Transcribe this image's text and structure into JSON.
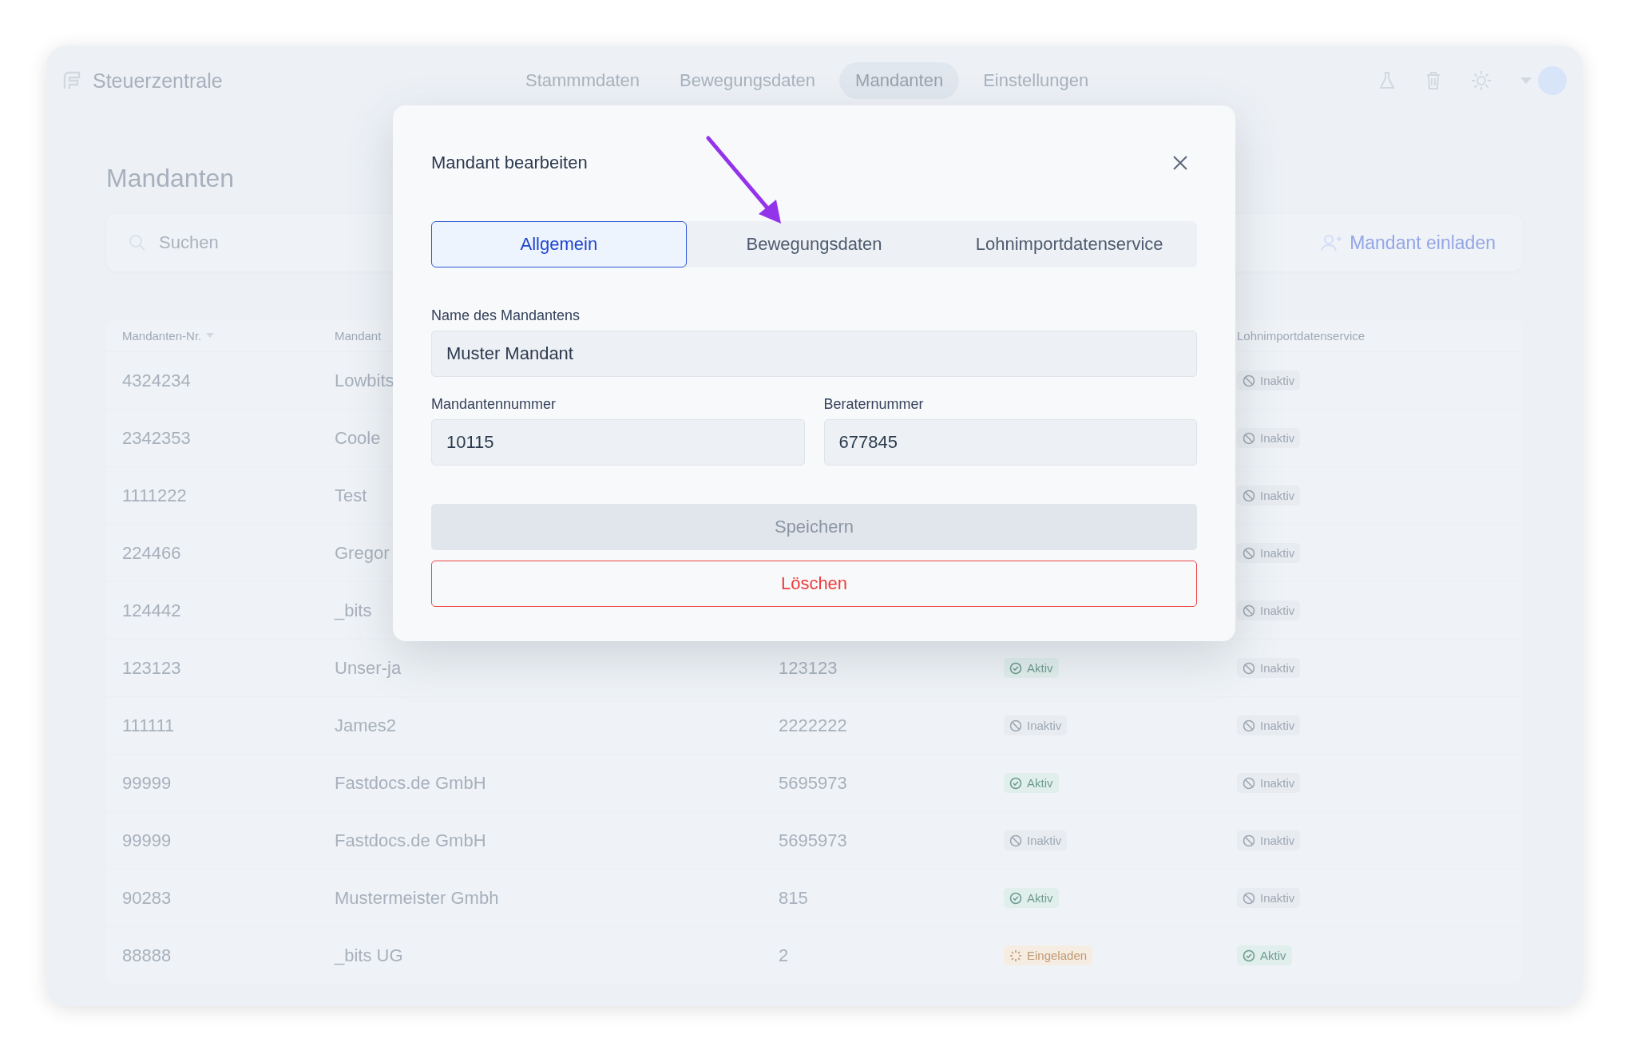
{
  "app": {
    "name": "Steuerzentrale"
  },
  "nav": [
    {
      "label": "Stammmdaten",
      "selected": false
    },
    {
      "label": "Bewegungsdaten",
      "selected": false
    },
    {
      "label": "Mandanten",
      "selected": true
    },
    {
      "label": "Einstellungen",
      "selected": false
    }
  ],
  "page": {
    "title": "Mandanten"
  },
  "search": {
    "placeholder": "Suchen"
  },
  "invite_button": {
    "label": "Mandant einladen"
  },
  "table": {
    "header": {
      "number": {
        "label": "Mandanten-Nr.",
        "sorted": true
      },
      "name": {
        "label": "Mandant"
      },
      "payroll": {
        "label": "Lohnimportdatenservice"
      }
    },
    "rows": [
      {
        "number": "4324234",
        "name": "Lowbits",
        "payroll": {
          "kind": "inactive",
          "label": "Inaktiv"
        }
      },
      {
        "number": "2342353",
        "name": "Coole",
        "payroll": {
          "kind": "inactive",
          "label": "Inaktiv"
        }
      },
      {
        "number": "1111222",
        "name": "Test",
        "payroll": {
          "kind": "inactive",
          "label": "Inaktiv"
        }
      },
      {
        "number": "224466",
        "name": "Gregor",
        "payroll": {
          "kind": "inactive",
          "label": "Inaktiv"
        }
      },
      {
        "number": "124442",
        "name": "_bits",
        "payroll": {
          "kind": "inactive",
          "label": "Inaktiv"
        }
      },
      {
        "number": "123123",
        "name": "Unser-ja",
        "advisor": "123123",
        "status": {
          "kind": "active",
          "label": "Aktiv"
        },
        "payroll": {
          "kind": "inactive",
          "label": "Inaktiv"
        }
      },
      {
        "number": "111111",
        "name": "James2",
        "advisor": "2222222",
        "status": {
          "kind": "inactive",
          "label": "Inaktiv"
        },
        "payroll": {
          "kind": "inactive",
          "label": "Inaktiv"
        }
      },
      {
        "number": "99999",
        "name": "Fastdocs.de GmbH",
        "advisor": "5695973",
        "status": {
          "kind": "active",
          "label": "Aktiv"
        },
        "payroll": {
          "kind": "inactive",
          "label": "Inaktiv"
        }
      },
      {
        "number": "99999",
        "name": "Fastdocs.de GmbH",
        "advisor": "5695973",
        "status": {
          "kind": "inactive",
          "label": "Inaktiv"
        },
        "payroll": {
          "kind": "inactive",
          "label": "Inaktiv"
        }
      },
      {
        "number": "90283",
        "name": "Mustermeister Gmbh",
        "advisor": "815",
        "status": {
          "kind": "active",
          "label": "Aktiv"
        },
        "payroll": {
          "kind": "inactive",
          "label": "Inaktiv"
        }
      },
      {
        "number": "88888",
        "name": "_bits UG",
        "advisor": "2",
        "status": {
          "kind": "invited",
          "label": "Eingeladen"
        },
        "payroll": {
          "kind": "active",
          "label": "Aktiv"
        }
      }
    ]
  },
  "modal": {
    "title": "Mandant bearbeiten",
    "tabs": [
      {
        "label": "Allgemein",
        "selected": true
      },
      {
        "label": "Bewegungsdaten",
        "selected": false
      },
      {
        "label": "Lohnimportdatenservice",
        "selected": false
      }
    ],
    "name_field": {
      "label": "Name des Mandantens",
      "value": "Muster Mandant"
    },
    "number_field": {
      "label": "Mandantennummer",
      "value": "10115"
    },
    "advisor_field": {
      "label": "Beraternummer",
      "value": "677845"
    },
    "save_button": {
      "label": "Speichern",
      "disabled": true
    },
    "delete_button": {
      "label": "Löschen"
    }
  }
}
